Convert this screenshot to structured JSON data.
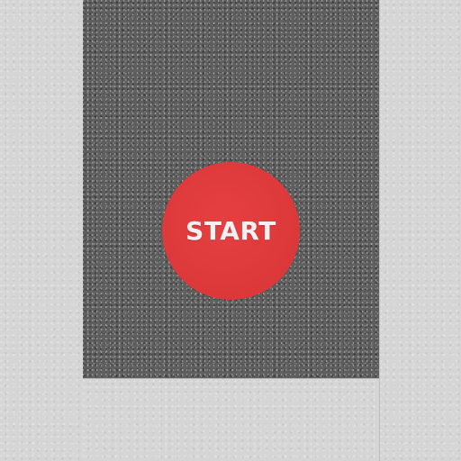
{
  "game": {
    "start_button_label": "START"
  },
  "colors": {
    "road": "#5f5f5f",
    "pavement": "#d5d5d5",
    "start_button": "#de3a3c",
    "start_text": "#f1f1f1"
  },
  "icons": {
    "start_button": "red-circle"
  }
}
